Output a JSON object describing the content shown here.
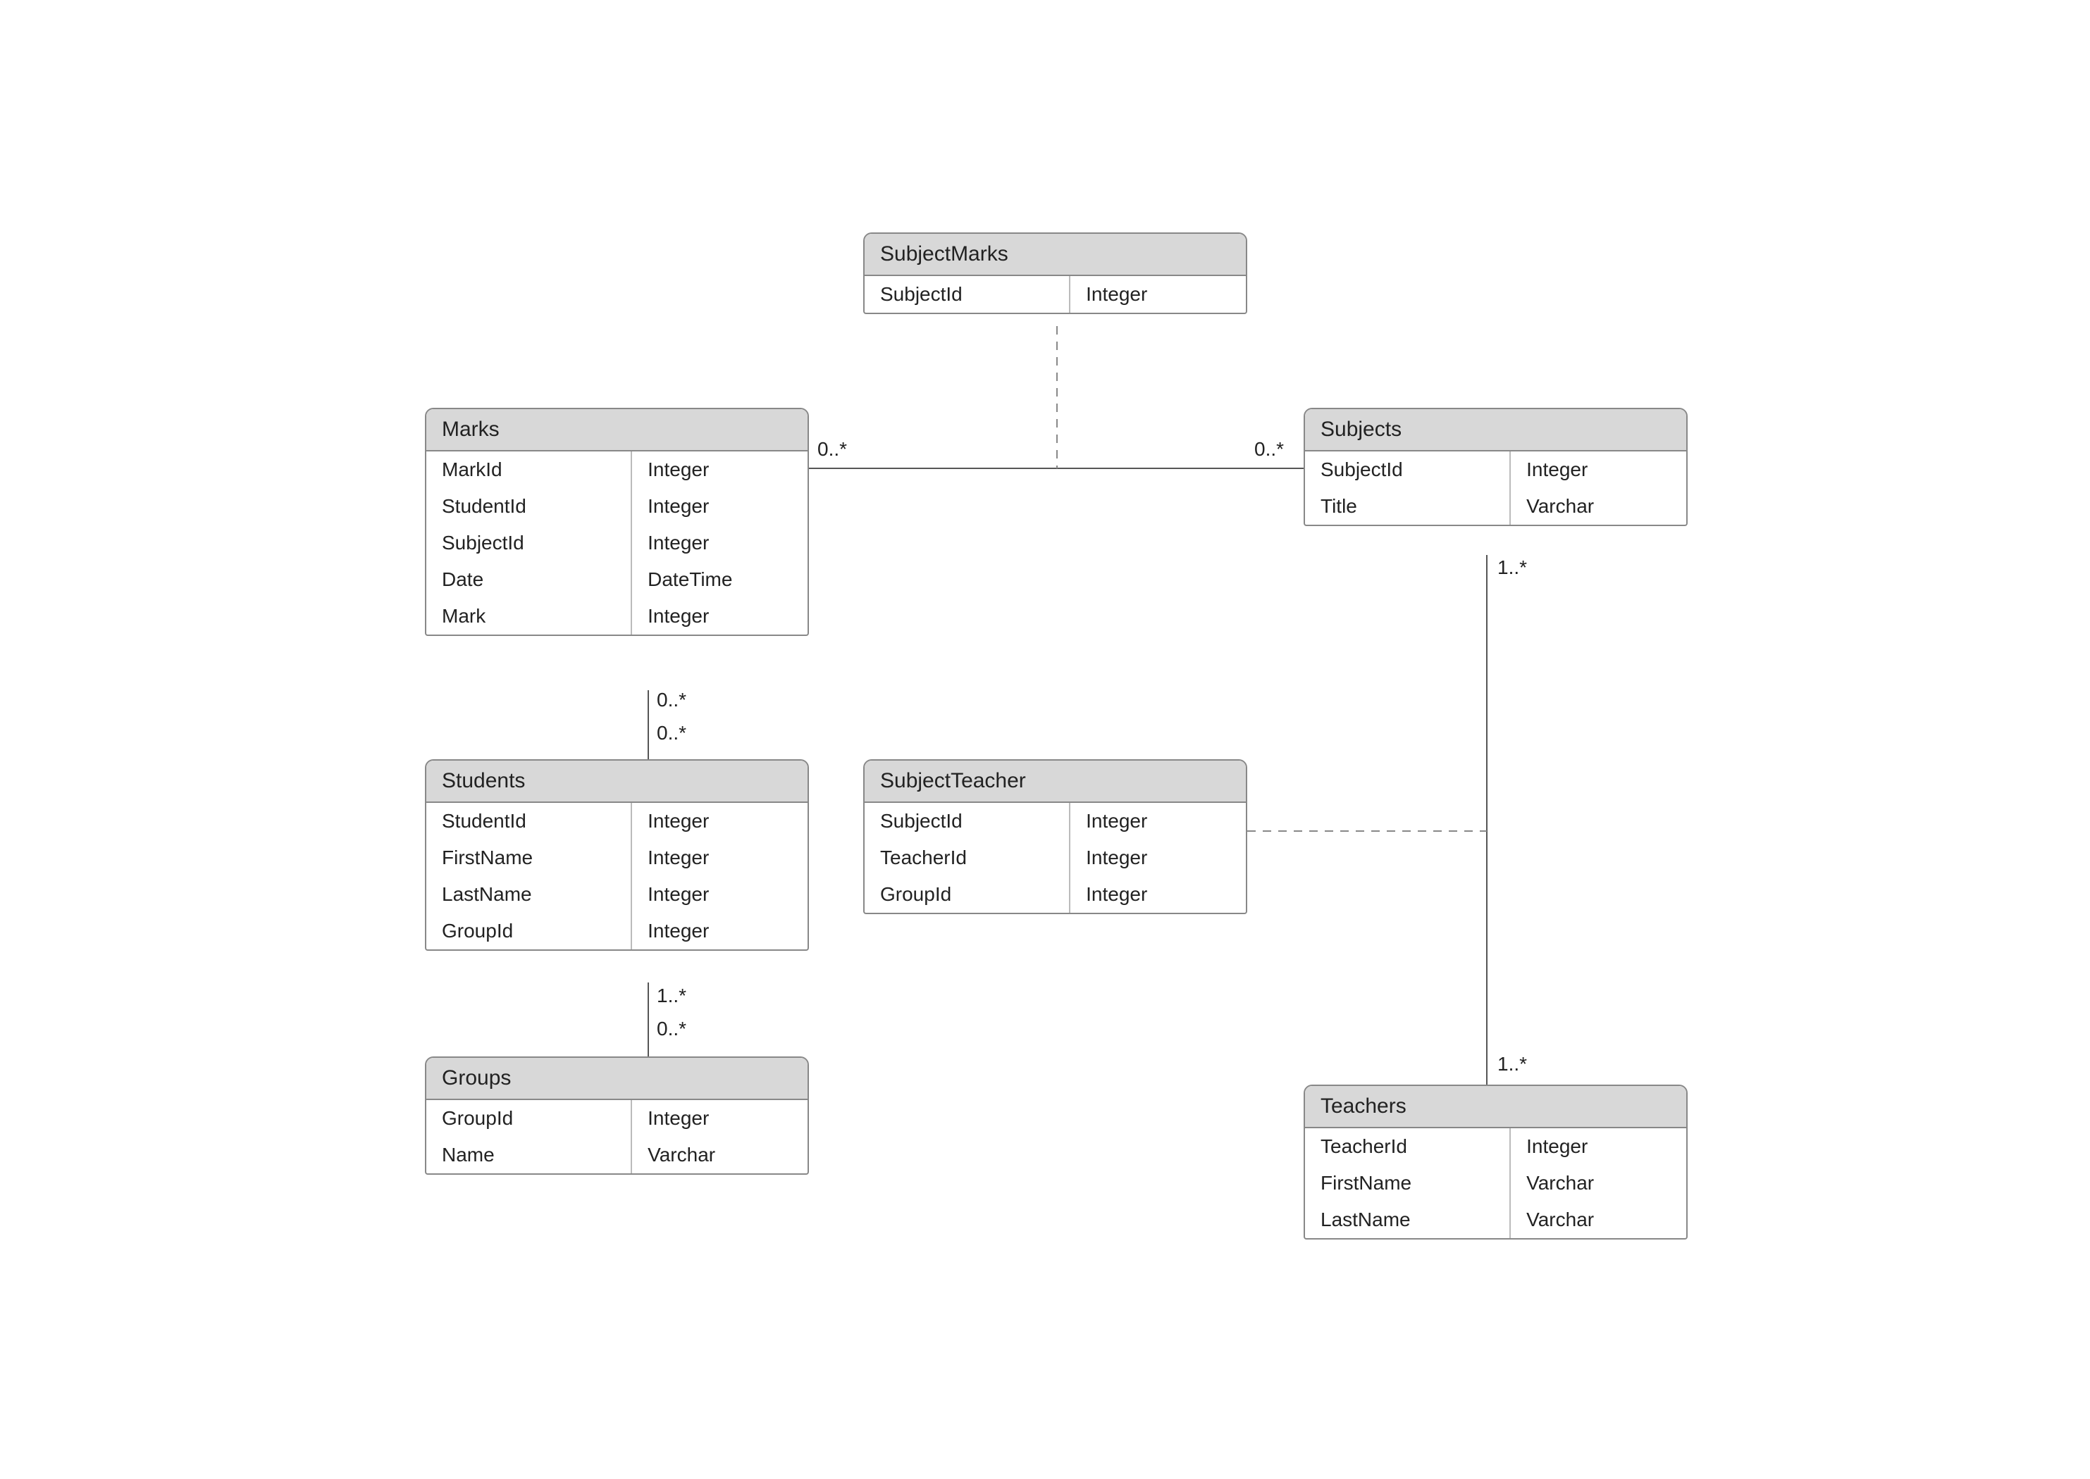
{
  "entities": {
    "subjectMarks": {
      "title": "SubjectMarks",
      "fields": [
        {
          "name": "SubjectId",
          "type": "Integer"
        }
      ]
    },
    "marks": {
      "title": "Marks",
      "fields": [
        {
          "name": "MarkId",
          "type": "Integer"
        },
        {
          "name": "StudentId",
          "type": "Integer"
        },
        {
          "name": "SubjectId",
          "type": "Integer"
        },
        {
          "name": "Date",
          "type": "DateTime"
        },
        {
          "name": "Mark",
          "type": "Integer"
        }
      ]
    },
    "subjects": {
      "title": "Subjects",
      "fields": [
        {
          "name": "SubjectId",
          "type": "Integer"
        },
        {
          "name": "Title",
          "type": "Varchar"
        }
      ]
    },
    "students": {
      "title": "Students",
      "fields": [
        {
          "name": "StudentId",
          "type": "Integer"
        },
        {
          "name": "FirstName",
          "type": "Integer"
        },
        {
          "name": "LastName",
          "type": "Integer"
        },
        {
          "name": "GroupId",
          "type": "Integer"
        }
      ]
    },
    "subjectTeacher": {
      "title": "SubjectTeacher",
      "fields": [
        {
          "name": "SubjectId",
          "type": "Integer"
        },
        {
          "name": "TeacherId",
          "type": "Integer"
        },
        {
          "name": "GroupId",
          "type": "Integer"
        }
      ]
    },
    "groups": {
      "title": "Groups",
      "fields": [
        {
          "name": "GroupId",
          "type": "Integer"
        },
        {
          "name": "Name",
          "type": "Varchar"
        }
      ]
    },
    "teachers": {
      "title": "Teachers",
      "fields": [
        {
          "name": "TeacherId",
          "type": "Integer"
        },
        {
          "name": "FirstName",
          "type": "Varchar"
        },
        {
          "name": "LastName",
          "type": "Varchar"
        }
      ]
    }
  },
  "multiplicities": {
    "marks_to_subjects_left": "0..*",
    "marks_to_subjects_right": "0..*",
    "marks_to_students_top": "0..*",
    "marks_to_students_bottom": "0..*",
    "subjects_to_teachers_top": "1..*",
    "subjects_to_teachers_bot": "1..*",
    "students_to_groups_top": "1..*",
    "students_to_groups_bot": "0..*"
  }
}
